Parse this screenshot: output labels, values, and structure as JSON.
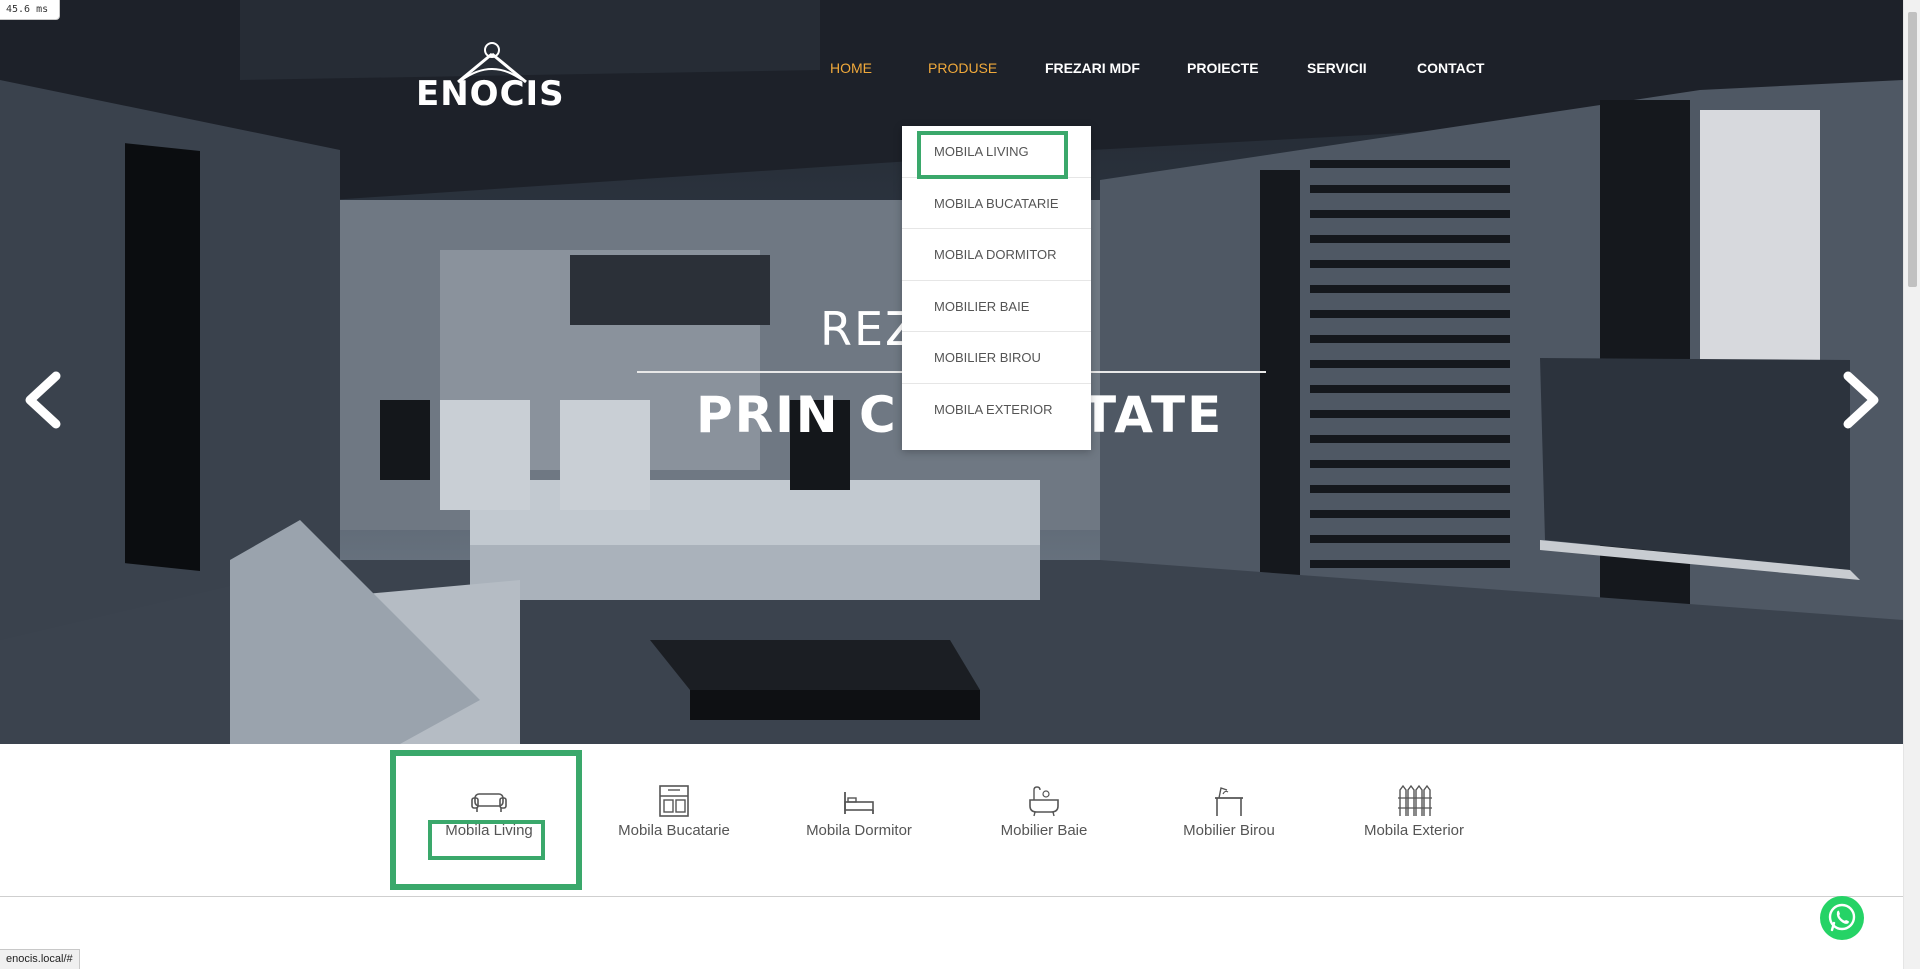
{
  "timing": "45.6 ms",
  "logo": {
    "text": "ENOCIS"
  },
  "nav": {
    "items": [
      {
        "label": "HOME"
      },
      {
        "label": "PRODUSE"
      },
      {
        "label": "FREZARI MDF"
      },
      {
        "label": "PROIECTE"
      },
      {
        "label": "SERVICII"
      },
      {
        "label": "CONTACT"
      }
    ],
    "active_color": "#f0a93b"
  },
  "dropdown": {
    "items": [
      {
        "label": "MOBILA LIVING"
      },
      {
        "label": "MOBILA BUCATARIE"
      },
      {
        "label": "MOBILA DORMITOR"
      },
      {
        "label": "MOBILIER BAIE"
      },
      {
        "label": "MOBILIER BIROU"
      },
      {
        "label": "MOBILA EXTERIOR"
      }
    ]
  },
  "hero": {
    "title_line1_visible": "REZ",
    "title_line2_left": "PRIN CR",
    "title_line2_right": "TATE",
    "prev_icon": "chevron-left-icon",
    "next_icon": "chevron-right-icon"
  },
  "categories": [
    {
      "label": "Mobila Living",
      "icon": "sofa-icon"
    },
    {
      "label": "Mobila Bucatarie",
      "icon": "kitchen-cabinet-icon"
    },
    {
      "label": "Mobila Dormitor",
      "icon": "bed-icon"
    },
    {
      "label": "Mobilier Baie",
      "icon": "bathtub-icon"
    },
    {
      "label": "Mobilier Birou",
      "icon": "office-desk-icon"
    },
    {
      "label": "Mobila Exterior",
      "icon": "fence-icon"
    }
  ],
  "highlight_color": "#3aa86b",
  "whatsapp": {
    "icon": "whatsapp-icon",
    "color": "#25d366"
  },
  "status_url": "enocis.local/#"
}
